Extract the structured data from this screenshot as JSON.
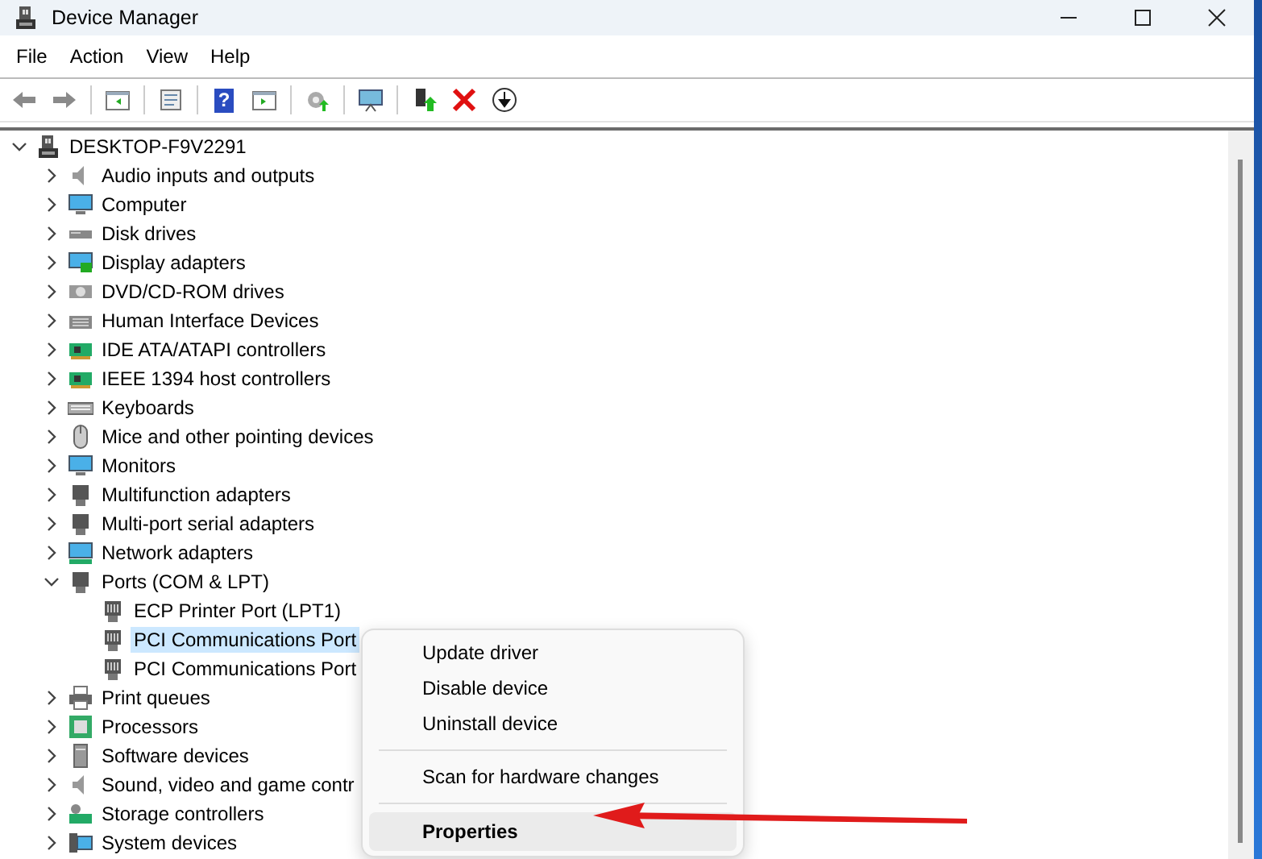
{
  "window": {
    "title": "Device Manager"
  },
  "menu_bar": [
    "File",
    "Action",
    "View",
    "Help"
  ],
  "toolbar": {
    "help_glyph": "?"
  },
  "tree": {
    "label": "DESKTOP-F9V2291",
    "expanded": true,
    "selected": false,
    "children": [
      {
        "label": "Audio inputs and outputs",
        "expanded": false,
        "selected": false
      },
      {
        "label": "Computer",
        "expanded": false,
        "selected": false
      },
      {
        "label": "Disk drives",
        "expanded": false,
        "selected": false
      },
      {
        "label": "Display adapters",
        "expanded": false,
        "selected": false
      },
      {
        "label": "DVD/CD-ROM drives",
        "expanded": false,
        "selected": false
      },
      {
        "label": "Human Interface Devices",
        "expanded": false,
        "selected": false
      },
      {
        "label": "IDE ATA/ATAPI controllers",
        "expanded": false,
        "selected": false
      },
      {
        "label": "IEEE 1394 host controllers",
        "expanded": false,
        "selected": false
      },
      {
        "label": "Keyboards",
        "expanded": false,
        "selected": false
      },
      {
        "label": "Mice and other pointing devices",
        "expanded": false,
        "selected": false
      },
      {
        "label": "Monitors",
        "expanded": false,
        "selected": false
      },
      {
        "label": "Multifunction adapters",
        "expanded": false,
        "selected": false
      },
      {
        "label": "Multi-port serial adapters",
        "expanded": false,
        "selected": false
      },
      {
        "label": "Network adapters",
        "expanded": false,
        "selected": false
      },
      {
        "label": "Ports (COM & LPT)",
        "expanded": true,
        "selected": false,
        "children": [
          {
            "label": "ECP Printer Port (LPT1)",
            "selected": false
          },
          {
            "label": "PCI Communications Port",
            "selected": true
          },
          {
            "label": "PCI Communications Port",
            "selected": false
          }
        ]
      },
      {
        "label": "Print queues",
        "expanded": false,
        "selected": false
      },
      {
        "label": "Processors",
        "expanded": false,
        "selected": false
      },
      {
        "label": "Software devices",
        "expanded": false,
        "selected": false
      },
      {
        "label": "Sound, video and game contr",
        "expanded": false,
        "selected": false
      },
      {
        "label": "Storage controllers",
        "expanded": false,
        "selected": false
      },
      {
        "label": "System devices",
        "expanded": false,
        "selected": false
      }
    ]
  },
  "context_menu": [
    {
      "kind": "item",
      "label": "Update driver",
      "highlighted": false
    },
    {
      "kind": "item",
      "label": "Disable device",
      "highlighted": false
    },
    {
      "kind": "item",
      "label": "Uninstall device",
      "highlighted": false
    },
    {
      "kind": "separator"
    },
    {
      "kind": "item",
      "label": "Scan for hardware changes",
      "highlighted": false
    },
    {
      "kind": "separator"
    },
    {
      "kind": "item",
      "label": "Properties",
      "highlighted": true
    }
  ]
}
